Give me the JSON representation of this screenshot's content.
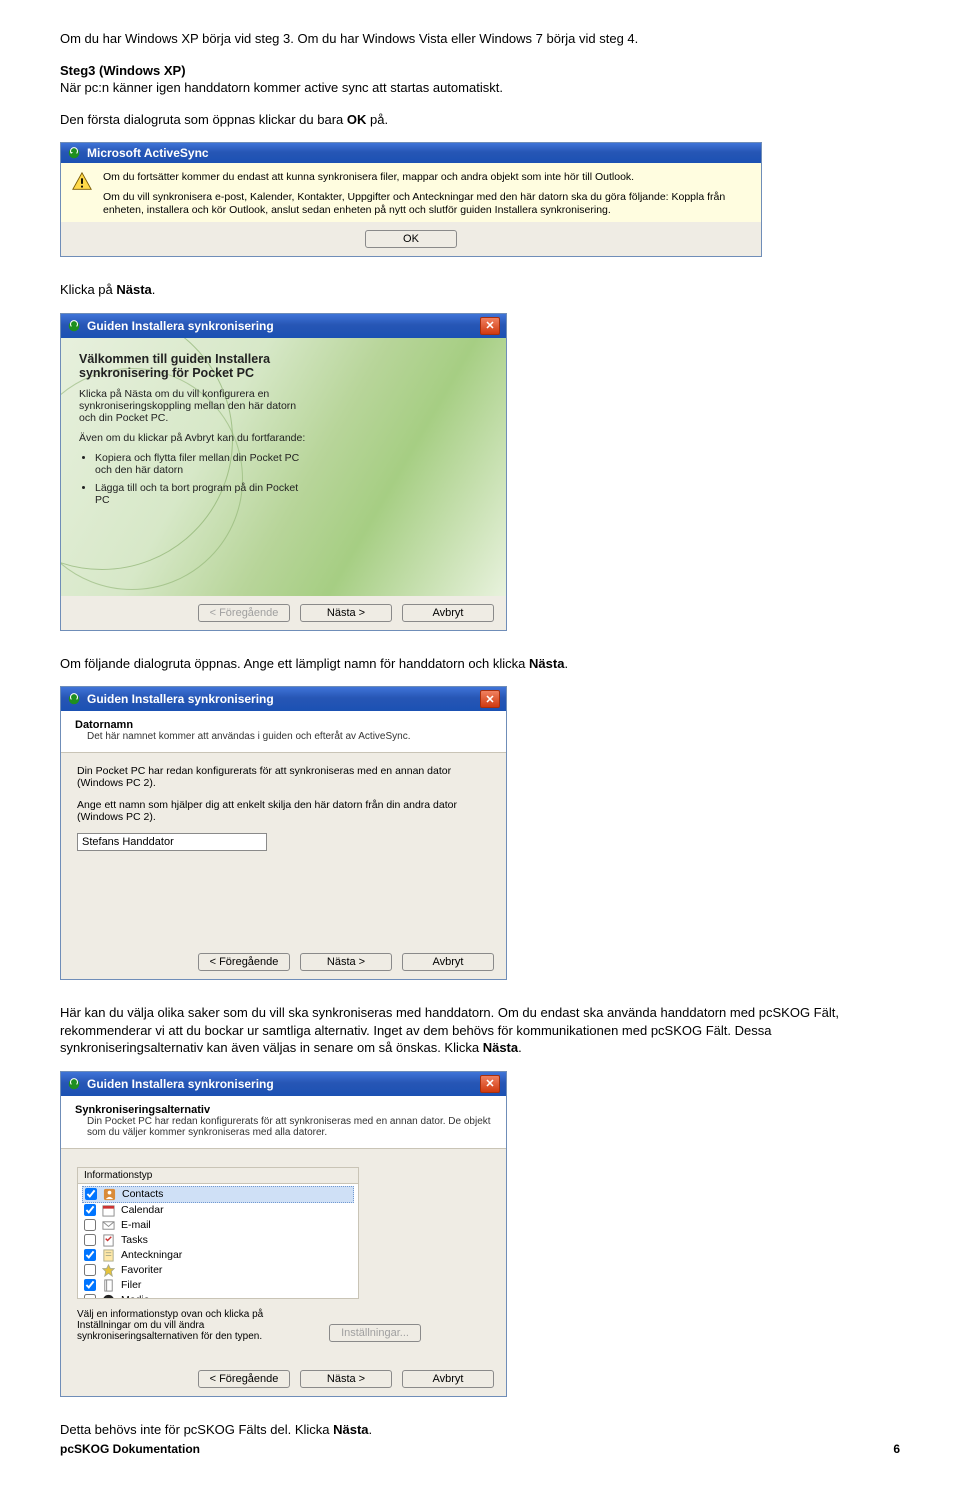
{
  "intro": {
    "p1_a": "Om du har Windows XP börja vid steg 3. Om du har Windows Vista eller Windows 7 börja vid steg 4.",
    "step3_label": "Steg3 (Windows XP)",
    "step3_text": "När pc:n känner igen handdatorn kommer active sync att startas automatiskt.",
    "p2_a": "Den första dialogruta som öppnas klickar du bara ",
    "p2_b": "OK",
    "p2_c": " på."
  },
  "activesync": {
    "title": "Microsoft ActiveSync",
    "line1": "Om du fortsätter kommer du endast att kunna synkronisera filer, mappar och andra objekt som inte hör till Outlook.",
    "line2": "Om du vill synkronisera e-post, Kalender, Kontakter, Uppgifter och Anteckningar med den här datorn ska du göra följande: Koppla från enheten, installera och kör Outlook, anslut sedan enheten på nytt och slutför guiden Installera synkronisering.",
    "ok": "OK"
  },
  "after_as": {
    "a": "Klicka på ",
    "b": "Nästa",
    "c": "."
  },
  "wizard_common": {
    "title": "Guiden Installera synkronisering",
    "back": "< Föregående",
    "next": "Nästa >",
    "cancel": "Avbryt",
    "settings": "Inställningar..."
  },
  "welcome": {
    "heading": "Välkommen till guiden Installera synkronisering för Pocket PC",
    "p1": "Klicka på Nästa om du vill konfigurera en synkroniseringskoppling mellan den här datorn och din Pocket PC.",
    "p2": "Även om du klickar på Avbryt kan du fortfarande:",
    "li1": "Kopiera och flytta filer mellan din Pocket PC och den här datorn",
    "li2": "Lägga till och ta bort program på din Pocket PC"
  },
  "after_welcome": {
    "a": "Om följande dialogruta öppnas. Ange ett lämpligt namn för handdatorn och klicka ",
    "b": "Nästa",
    "c": "."
  },
  "devicename": {
    "hdr_title": "Datornamn",
    "hdr_sub": "Det här namnet kommer att användas i guiden och efteråt av ActiveSync.",
    "body_p1": "Din Pocket PC har redan konfigurerats för att synkroniseras med en annan dator (Windows PC 2).",
    "body_p2": "Ange ett namn som hjälper dig att enkelt skilja den här datorn från din andra dator (Windows PC 2).",
    "value": "Stefans Handdator"
  },
  "after_devicename": {
    "p_a": "Här kan du välja olika saker som du vill ska synkroniseras med handdatorn. Om du endast ska använda handdatorn med pcSKOG Fält, rekommenderar vi att du bockar ur samtliga alternativ. Inget av dem behövs för kommunikationen med pcSKOG Fält. Dessa synkroniseringsalternativ kan även väljas in senare om så önskas. Klicka ",
    "p_b": "Nästa",
    "p_c": "."
  },
  "syncopts": {
    "hdr_title": "Synkroniseringsalternativ",
    "hdr_sub": "Din Pocket PC har redan konfigurerats för att synkroniseras med en annan dator. De objekt som du väljer kommer synkroniseras med alla datorer.",
    "col": "Informationstyp",
    "items": [
      {
        "label": "Contacts",
        "checked": true,
        "selected": true,
        "icon": "contacts"
      },
      {
        "label": "Calendar",
        "checked": true,
        "icon": "calendar"
      },
      {
        "label": "E-mail",
        "checked": false,
        "icon": "mail"
      },
      {
        "label": "Tasks",
        "checked": false,
        "icon": "tasks"
      },
      {
        "label": "Anteckningar",
        "checked": true,
        "icon": "notes"
      },
      {
        "label": "Favoriter",
        "checked": false,
        "icon": "star"
      },
      {
        "label": "Filer",
        "checked": true,
        "icon": "files"
      },
      {
        "label": "Media",
        "checked": false,
        "icon": "media"
      }
    ],
    "note": "Välj en informationstyp ovan och klicka på Inställningar om du vill ändra synkroniseringsalternativen för den typen."
  },
  "after_syncopts": {
    "a": "Detta behövs inte för pcSKOG Fälts del. Klicka ",
    "b": "Nästa",
    "c": "."
  },
  "footer": {
    "doc": "pcSKOG Dokumentation",
    "page": "6"
  }
}
